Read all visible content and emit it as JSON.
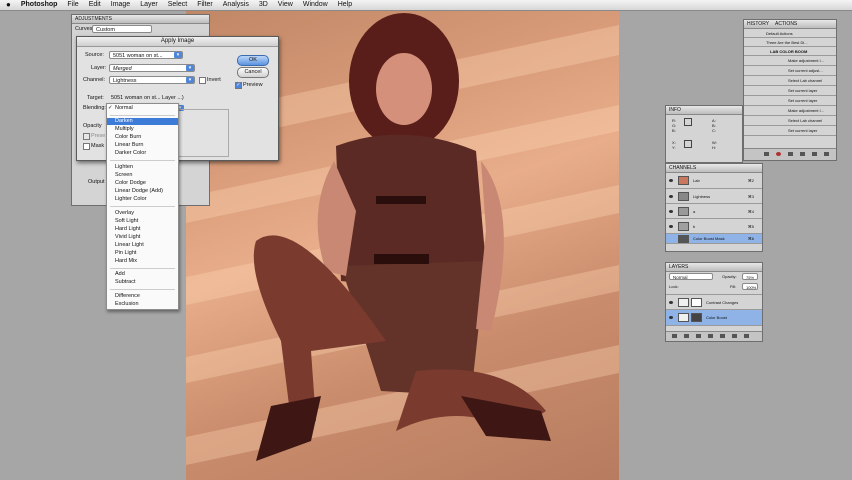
{
  "menubar": {
    "apple": "",
    "items": [
      "Photoshop",
      "File",
      "Edit",
      "Image",
      "Layer",
      "Select",
      "Filter",
      "Analysis",
      "3D",
      "View",
      "Window",
      "Help"
    ]
  },
  "adjustments_panel": {
    "title": "ADJUSTMENTS",
    "label": "Curves",
    "preset_value": "Custom"
  },
  "dialog": {
    "title": "Apply Image",
    "source_label": "Source:",
    "source_value": "5051 woman on st...",
    "layer_label": "Layer:",
    "layer_value": "Merged",
    "channel_label": "Channel:",
    "channel_value": "Lightness",
    "invert_label": "Invert",
    "target_label": "Target:",
    "target_value": "5051 woman on st... Layer ...)",
    "blending_label": "Blending:",
    "blending_value": "Normal",
    "opacity_label": "Opacity",
    "preserve_label": "Prese",
    "mask_label": "Mask",
    "ok_label": "OK",
    "cancel_label": "Cancel",
    "preview_label": "Preview",
    "output_label": "Output"
  },
  "dropdown": {
    "checked_item": "Normal",
    "highlighted": "Darken",
    "groups": [
      [
        "Darken",
        "Multiply",
        "Color Burn",
        "Linear Burn",
        "Darker Color"
      ],
      [
        "Lighten",
        "Screen",
        "Color Dodge",
        "Linear Dodge (Add)",
        "Lighter Color"
      ],
      [
        "Overlay",
        "Soft Light",
        "Hard Light",
        "Vivid Light",
        "Linear Light",
        "Pin Light",
        "Hard Mix"
      ],
      [
        "Add",
        "Subtract"
      ],
      [
        "Difference",
        "Exclusion"
      ]
    ]
  },
  "actions_panel": {
    "tabs": [
      "HISTORY",
      "ACTIONS"
    ],
    "items": [
      "Default Actions",
      "Three Are the Best Di...",
      "LAB COLOR BOOM",
      "Make adjustment l...",
      "Set current adjust...",
      "Select Lab channel",
      "Set current layer",
      "Set current layer",
      "Make adjustment l...",
      "Select Lab channel",
      "Set current layer"
    ]
  },
  "info_panel": {
    "title": "INFO",
    "labels": [
      "R:",
      "G:",
      "B:",
      "A:",
      "B:",
      "C:",
      "X:",
      "Y:",
      "W:",
      "H:"
    ]
  },
  "channels_panel": {
    "title": "CHANNELS",
    "items": [
      "Lab",
      "Lightness",
      "a",
      "b",
      "Color Boost Mask"
    ],
    "shortcuts": [
      "⌘2",
      "⌘3",
      "⌘4",
      "⌘5",
      "⌘6"
    ]
  },
  "layers_panel": {
    "title": "LAYERS",
    "blend_mode": "Normal",
    "opacity_label": "Opacity:",
    "opacity_value": "75%",
    "fill_label": "Fill:",
    "fill_value": "100%",
    "lock_label": "Lock:",
    "items": [
      "Contrast Changes",
      "Color Boost"
    ]
  },
  "colors": {
    "menu_highlight": "#3d7bd9",
    "panel_bg": "#d4d4d4",
    "photo_warm": "#d79a78"
  }
}
